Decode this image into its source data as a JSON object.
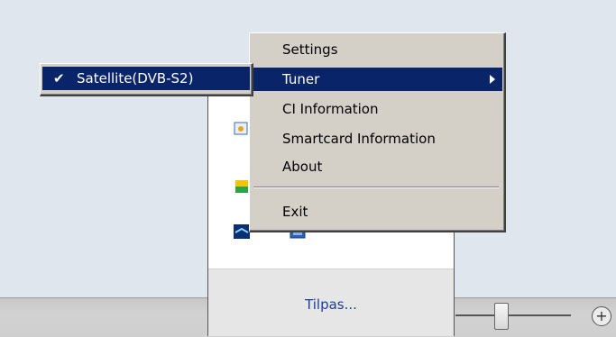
{
  "main_menu": {
    "items": [
      {
        "label": "Settings"
      },
      {
        "label": "Tuner"
      },
      {
        "label": "CI Information"
      },
      {
        "label": "Smartcard Information"
      },
      {
        "label": "About"
      },
      {
        "label": "Exit"
      }
    ]
  },
  "tuner_submenu": {
    "items": [
      {
        "label": "Satellite(DVB-S2)",
        "checked": true
      }
    ]
  },
  "tray_flyout": {
    "customize_link": "Tilpas..."
  },
  "taskbar": {
    "zoom_in_symbol": "+"
  },
  "colors": {
    "menu_bg": "#d4d0c8",
    "highlight": "#0a246a",
    "link": "#1c3f94",
    "desktop": "#dfe6ee"
  }
}
